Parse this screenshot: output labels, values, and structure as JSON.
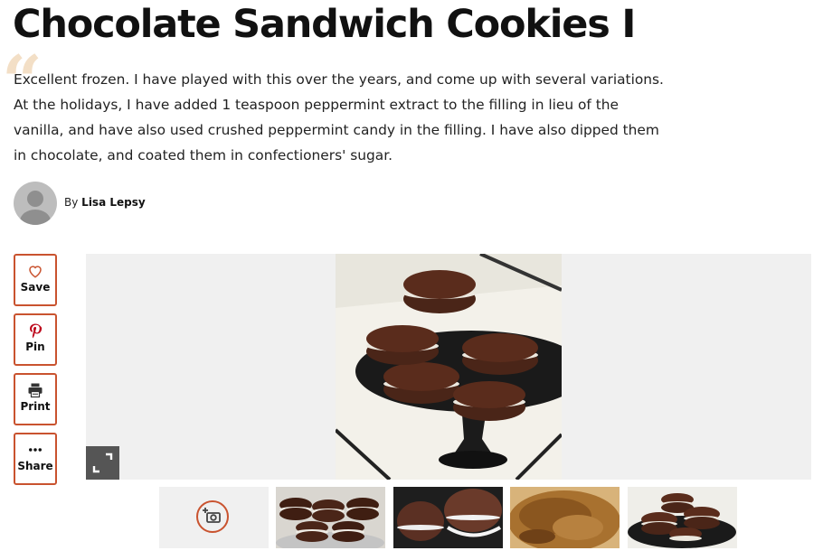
{
  "recipe": {
    "title": "Chocolate Sandwich Cookies I"
  },
  "review": {
    "text": "Excellent frozen. I have played with this over the years, and come up with several variations. At the holidays, I have added 1 teaspoon peppermint extract to the filling in lieu of the vanilla, and have also used crushed peppermint candy in the filling. I have also dipped them in chocolate, and coated them in confectioners' sugar.",
    "quote_glyph": "“",
    "by_prefix": "By",
    "author": "Lisa Lepsy"
  },
  "actions": [
    {
      "label": "Save",
      "icon": "heart-icon"
    },
    {
      "label": "Pin",
      "icon": "pinterest-icon"
    },
    {
      "label": "Print",
      "icon": "printer-icon"
    },
    {
      "label": "Share",
      "icon": "more-dots-icon"
    }
  ],
  "gallery": {
    "thumbnails": [
      {
        "kind": "add-photo",
        "icon": "add-photo-camera-icon"
      },
      {
        "kind": "photo"
      },
      {
        "kind": "photo"
      },
      {
        "kind": "photo"
      },
      {
        "kind": "photo"
      }
    ]
  },
  "colors": {
    "accent": "#c9532f",
    "pinterest": "#bd081c",
    "quote": "#f3dfc6",
    "gallery_background": "#f0f0f0"
  }
}
